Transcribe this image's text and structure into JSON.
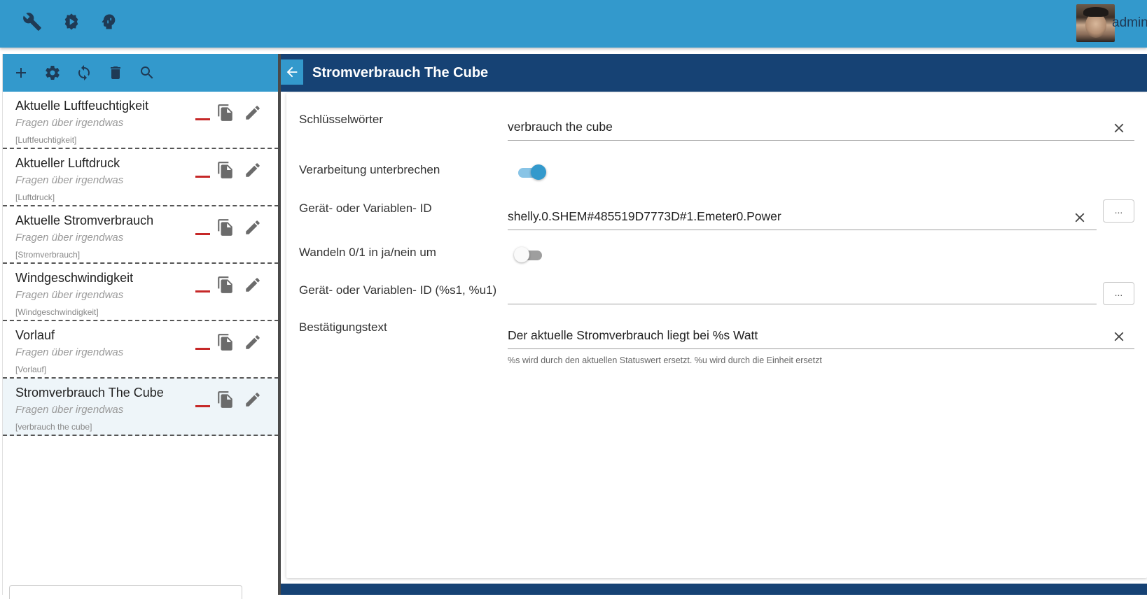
{
  "topbar": {
    "icons": [
      "wrench-icon",
      "gear-chip-icon",
      "head-icon"
    ],
    "user": {
      "name": "admin"
    }
  },
  "left_toolbar": {
    "icons": [
      "add-icon",
      "settings-icon",
      "refresh-icon",
      "delete-icon",
      "search-icon"
    ]
  },
  "rules": [
    {
      "title": "Aktuelle Luftfeuchtigkeit",
      "subtitle": "Fragen über irgendwas",
      "tag": "[Luftfeuchtigkeit]",
      "selected": false
    },
    {
      "title": "Aktueller Luftdruck",
      "subtitle": "Fragen über irgendwas",
      "tag": "[Luftdruck]",
      "selected": false
    },
    {
      "title": "Aktuelle Stromverbrauch",
      "subtitle": "Fragen über irgendwas",
      "tag": "[Stromverbrauch]",
      "selected": false
    },
    {
      "title": "Windgeschwindigkeit",
      "subtitle": "Fragen über irgendwas",
      "tag": "[Windgeschwindigkeit]",
      "selected": false
    },
    {
      "title": "Vorlauf",
      "subtitle": "Fragen über irgendwas",
      "tag": "[Vorlauf]",
      "selected": false
    },
    {
      "title": "Stromverbrauch The Cube",
      "subtitle": "Fragen über irgendwas",
      "tag": "[verbrauch the cube]",
      "selected": true
    }
  ],
  "detail": {
    "title": "Stromverbrauch The Cube",
    "keywords": {
      "label": "Schlüsselwörter",
      "value": "verbrauch the cube"
    },
    "interrupt": {
      "label": "Verarbeitung unterbrechen",
      "checked": true
    },
    "device_id": {
      "label": "Gerät- oder Variablen- ID",
      "value": "shelly.0.SHEM#485519D7773D#1.Emeter0.Power",
      "button": "..."
    },
    "convert": {
      "label": "Wandeln 0/1 in ja/nein um",
      "checked": false
    },
    "device_id2": {
      "label": "Gerät- oder Variablen- ID (%s1, %u1)",
      "value": "",
      "button": "..."
    },
    "confirm": {
      "label": "Bestätigungstext",
      "value": "Der aktuelle Stromverbrauch liegt bei %s Watt",
      "helper": "%s wird durch den aktuellen Statuswert ersetzt. %u wird durch die Einheit ersetzt"
    }
  },
  "colors": {
    "topbar": "#3399cc",
    "header": "#164274",
    "icon": "#1f3a55",
    "delete": "#c62828"
  }
}
